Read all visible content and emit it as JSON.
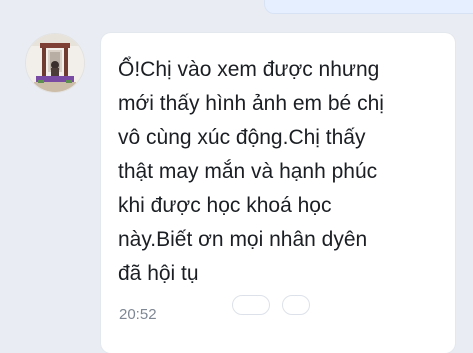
{
  "message": {
    "text": "Ổ!Chị vào xem được nhưng\nmới thấy hình ảnh em bé chị\nvô cùng xúc động.Chị thấy\nthật may mắn và hạnh phúc\nkhi được học khoá học\nnày.Biết ơn mọi nhân dyên\nđã hội tụ",
    "time": "20:52"
  },
  "colors": {
    "background": "#e9edf3",
    "bubble": "#ffffff",
    "outgoing_bubble": "#e5efff",
    "text": "#1b1f24",
    "timestamp": "#7f8794"
  }
}
